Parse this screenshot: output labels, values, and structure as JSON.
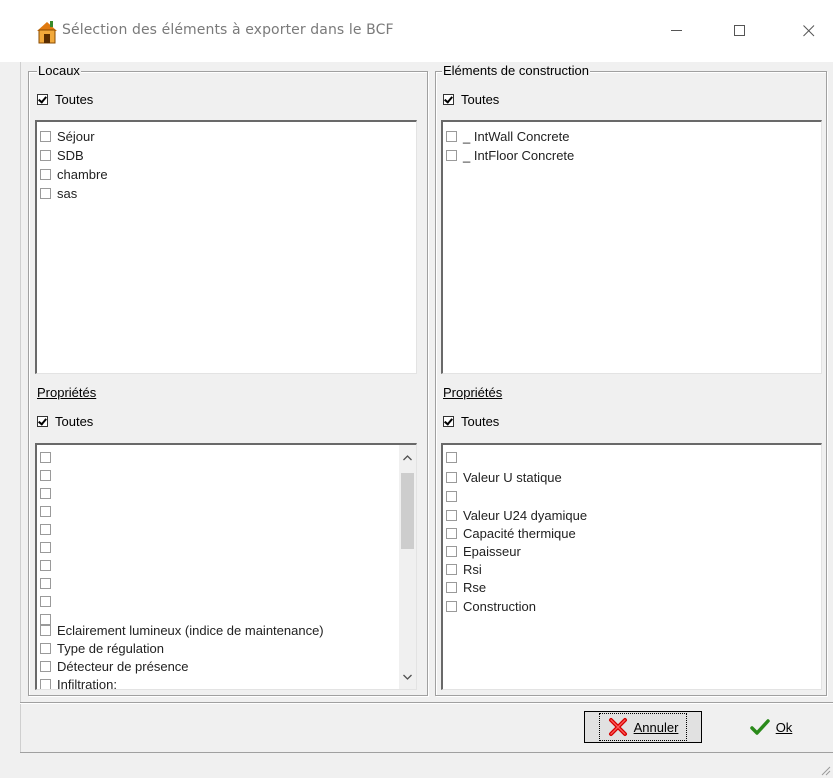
{
  "window": {
    "title": "Sélection des éléments à exporter dans le BCF",
    "icon": "house-app-icon"
  },
  "locaux": {
    "title": "Locaux",
    "select_all": "Toutes",
    "items": [
      "Séjour",
      "SDB",
      "chambre",
      "sas"
    ]
  },
  "elements": {
    "title": "Eléments de construction",
    "select_all": "Toutes",
    "items": [
      "_ IntWall Concrete",
      "_ IntFloor Concrete"
    ]
  },
  "props_left": {
    "title": "Propriétés",
    "select_all": "Toutes",
    "items": [
      "",
      "",
      "",
      "",
      "",
      "",
      "",
      "",
      "",
      "",
      "Eclairement lumineux (indice de maintenance)",
      "Type de régulation",
      "Détecteur de présence",
      "Infiltration:"
    ]
  },
  "props_right": {
    "title": "Propriétés",
    "select_all": "Toutes",
    "items": [
      "",
      "Valeur U statique",
      "",
      "Valeur U24 dyamique",
      "Capacité thermique",
      "Epaisseur",
      "Rsi",
      "Rse",
      "Construction"
    ]
  },
  "buttons": {
    "cancel": "Annuler",
    "ok": "Ok"
  },
  "colors": {
    "cancel_icon": "#d40000",
    "ok_icon": "#2a8a1a"
  }
}
